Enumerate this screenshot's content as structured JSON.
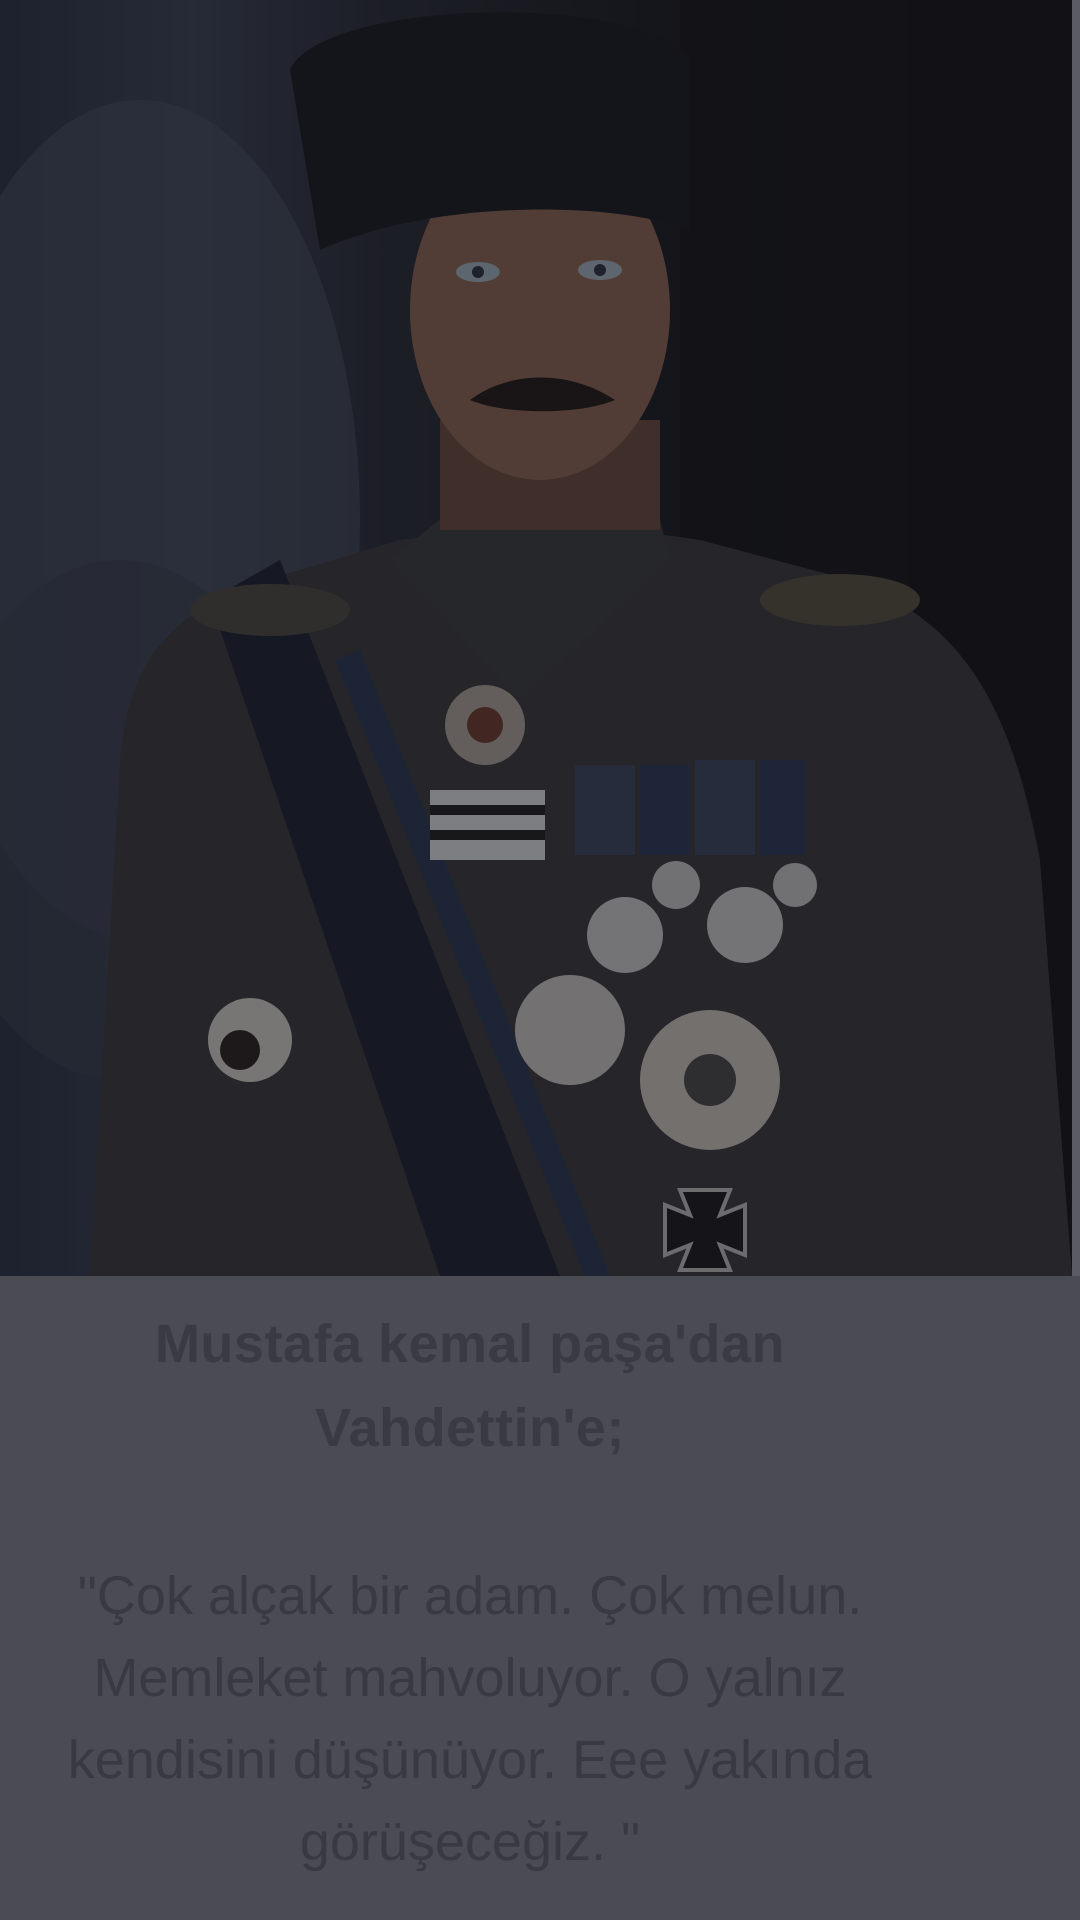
{
  "photo": {
    "icon": "portrait-photo"
  },
  "caption": {
    "title": "Mustafa kemal paşa'dan Vahdettin'e;",
    "quote": "\"Çok alçak bir adam. Çok melun. Memleket mahvoluyor. O yalnız kendisini düşünüyor. Eee yakında görüşeceğiz. \""
  },
  "colors": {
    "overlay": "#4a4b53",
    "text": "#3a3b42"
  }
}
